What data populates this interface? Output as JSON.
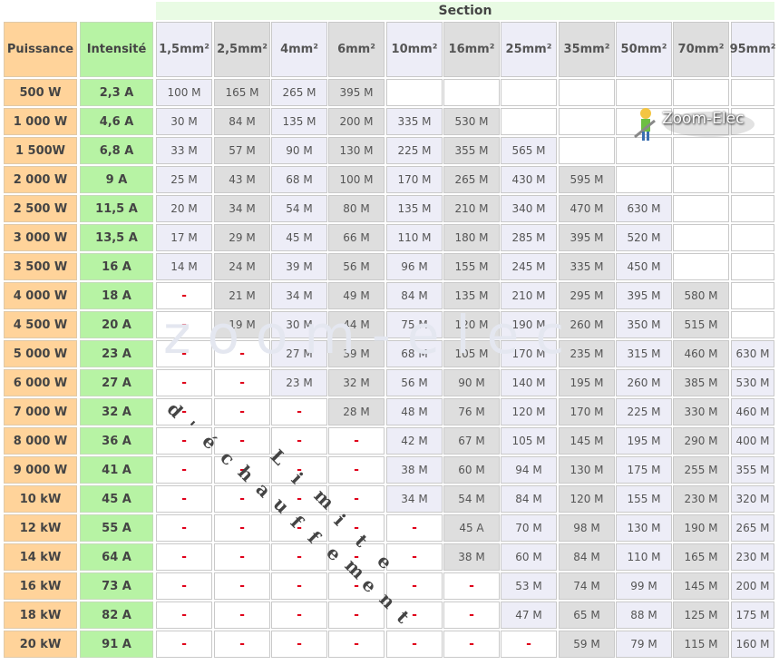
{
  "headers": {
    "section": "Section",
    "puissance": "Puissance",
    "intensite": "Intensité",
    "sections": [
      "1,5mm²",
      "2,5mm²",
      "4mm²",
      "6mm²",
      "10mm²",
      "16mm²",
      "25mm²",
      "35mm²",
      "50mm²",
      "70mm²",
      "95mm²"
    ]
  },
  "rows": [
    {
      "p": "500 W",
      "i": "2,3 A",
      "v": [
        "100 M",
        "165 M",
        "265 M",
        "395 M",
        "",
        "",
        "",
        "",
        "",
        "",
        ""
      ]
    },
    {
      "p": "1 000 W",
      "i": "4,6 A",
      "v": [
        "30 M",
        "84 M",
        "135 M",
        "200 M",
        "335 M",
        "530 M",
        "",
        "",
        "",
        "",
        ""
      ]
    },
    {
      "p": "1 500W",
      "i": "6,8 A",
      "v": [
        "33 M",
        "57 M",
        "90 M",
        "130 M",
        "225 M",
        "355 M",
        "565 M",
        "",
        "",
        "",
        ""
      ]
    },
    {
      "p": "2 000 W",
      "i": "9 A",
      "v": [
        "25 M",
        "43 M",
        "68 M",
        "100 M",
        "170 M",
        "265 M",
        "430 M",
        "595 M",
        "",
        "",
        ""
      ]
    },
    {
      "p": "2 500 W",
      "i": "11,5 A",
      "v": [
        "20 M",
        "34 M",
        "54 M",
        "80 M",
        "135 M",
        "210 M",
        "340 M",
        "470 M",
        "630 M",
        "",
        ""
      ]
    },
    {
      "p": "3 000 W",
      "i": "13,5 A",
      "v": [
        "17 M",
        "29 M",
        "45 M",
        "66 M",
        "110 M",
        "180 M",
        "285 M",
        "395 M",
        "520 M",
        "",
        ""
      ]
    },
    {
      "p": "3 500 W",
      "i": "16 A",
      "v": [
        "14 M",
        "24 M",
        "39 M",
        "56 M",
        "96 M",
        "155 M",
        "245 M",
        "335 M",
        "450 M",
        "",
        ""
      ]
    },
    {
      "p": "4 000 W",
      "i": "18 A",
      "v": [
        "-",
        "21 M",
        "34 M",
        "49 M",
        "84 M",
        "135 M",
        "210 M",
        "295 M",
        "395 M",
        "580 M",
        ""
      ]
    },
    {
      "p": "4 500 W",
      "i": "20 A",
      "v": [
        "-",
        "19 M",
        "30 M",
        "44 M",
        "75 M",
        "120 M",
        "190 M",
        "260 M",
        "350 M",
        "515 M",
        ""
      ]
    },
    {
      "p": "5 000 W",
      "i": "23 A",
      "v": [
        "-",
        "-",
        "27 M",
        "39 M",
        "68 M",
        "105 M",
        "170 M",
        "235 M",
        "315 M",
        "460 M",
        "630 M"
      ]
    },
    {
      "p": "6 000 W",
      "i": "27 A",
      "v": [
        "-",
        "-",
        "23 M",
        "32 M",
        "56 M",
        "90 M",
        "140 M",
        "195 M",
        "260 M",
        "385 M",
        "530 M"
      ]
    },
    {
      "p": "7 000 W",
      "i": "32 A",
      "v": [
        "-",
        "-",
        "-",
        "28 M",
        "48 M",
        "76 M",
        "120 M",
        "170 M",
        "225 M",
        "330 M",
        "460 M"
      ]
    },
    {
      "p": "8 000 W",
      "i": "36 A",
      "v": [
        "-",
        "-",
        "-",
        "-",
        "42 M",
        "67 M",
        "105 M",
        "145 M",
        "195 M",
        "290 M",
        "400 M"
      ]
    },
    {
      "p": "9 000 W",
      "i": "41 A",
      "v": [
        "-",
        "-",
        "-",
        "-",
        "38 M",
        "60 M",
        "94 M",
        "130 M",
        "175 M",
        "255 M",
        "355 M"
      ]
    },
    {
      "p": "10 kW",
      "i": "45 A",
      "v": [
        "-",
        "-",
        "-",
        "-",
        "34 M",
        "54 M",
        "84 M",
        "120 M",
        "155 M",
        "230 M",
        "320 M"
      ]
    },
    {
      "p": "12 kW",
      "i": "55 A",
      "v": [
        "-",
        "-",
        "-",
        "-",
        "-",
        "45 A",
        "70 M",
        "98 M",
        "130 M",
        "190 M",
        "265 M"
      ]
    },
    {
      "p": "14 kW",
      "i": "64 A",
      "v": [
        "-",
        "-",
        "-",
        "-",
        "-",
        "38 M",
        "60 M",
        "84 M",
        "110 M",
        "165 M",
        "230 M"
      ]
    },
    {
      "p": "16 kW",
      "i": "73 A",
      "v": [
        "-",
        "-",
        "-",
        "-",
        "-",
        "-",
        "53 M",
        "74 M",
        "99 M",
        "145 M",
        "200 M"
      ]
    },
    {
      "p": "18 kW",
      "i": "82 A",
      "v": [
        "-",
        "-",
        "-",
        "-",
        "-",
        "-",
        "47 M",
        "65 M",
        "88 M",
        "125 M",
        "175 M"
      ]
    },
    {
      "p": "20 kW",
      "i": "91 A",
      "v": [
        "-",
        "-",
        "-",
        "-",
        "-",
        "-",
        "-",
        "59 M",
        "79 M",
        "115 M",
        "160 M"
      ]
    }
  ],
  "diagonal_text": "Limite d'échauffement",
  "watermark": "zoom-elec",
  "logo": {
    "text": "Zoom-Elec",
    "icon": "electrician-icon"
  },
  "colors": {
    "power": "#ffd39a",
    "current": "#b7f3a4",
    "section_header": "#e9fbe4",
    "cell_light": "#ededf7",
    "cell_dark": "#dedede",
    "dash": "#e0001b"
  }
}
